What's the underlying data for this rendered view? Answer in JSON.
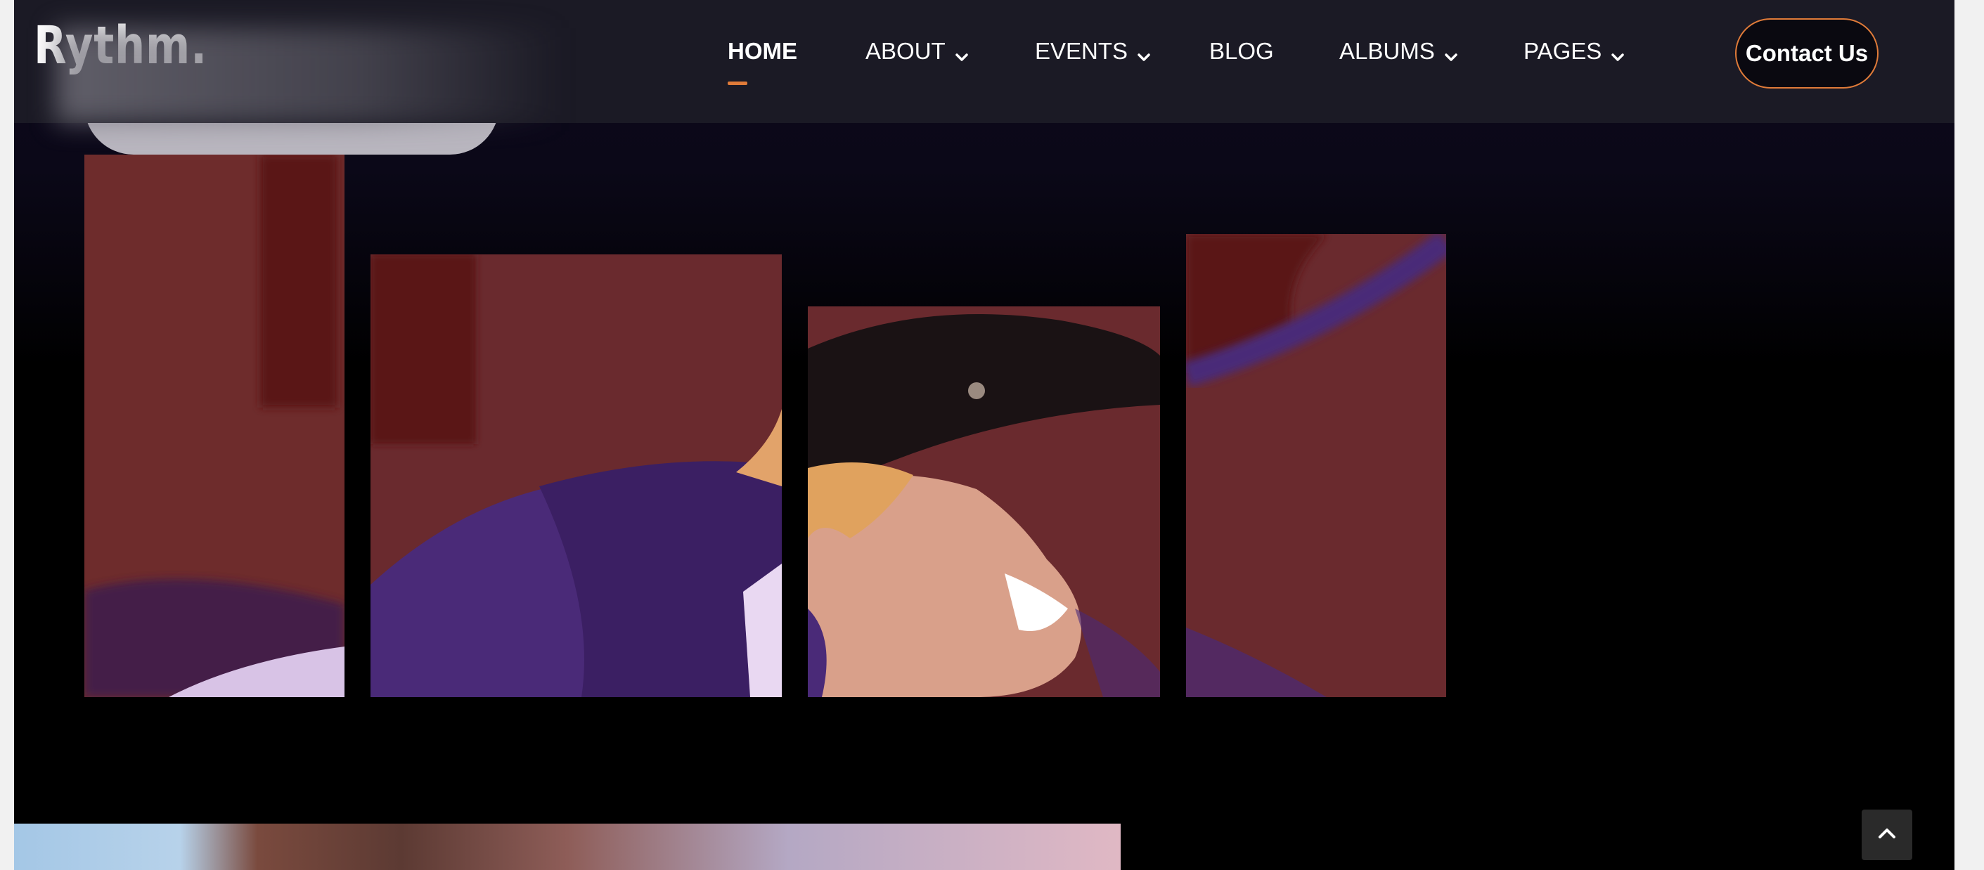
{
  "brand": {
    "logo": "Rythm."
  },
  "nav": {
    "items": [
      {
        "label": "HOME",
        "active": true,
        "dropdown": false
      },
      {
        "label": "ABOUT",
        "active": false,
        "dropdown": true
      },
      {
        "label": "EVENTS",
        "active": false,
        "dropdown": true
      },
      {
        "label": "BLOG",
        "active": false,
        "dropdown": false
      },
      {
        "label": "ALBUMS",
        "active": false,
        "dropdown": true
      },
      {
        "label": "PAGES",
        "active": false,
        "dropdown": true
      }
    ]
  },
  "header": {
    "cta_label": "Contact Us"
  },
  "colors": {
    "accent": "#e07b39",
    "header_bg": "#1b1a25",
    "page_bg": "#000000"
  },
  "icons": {
    "dropdown": "chevron-down-icon",
    "scroll_top": "chevron-up-icon"
  }
}
